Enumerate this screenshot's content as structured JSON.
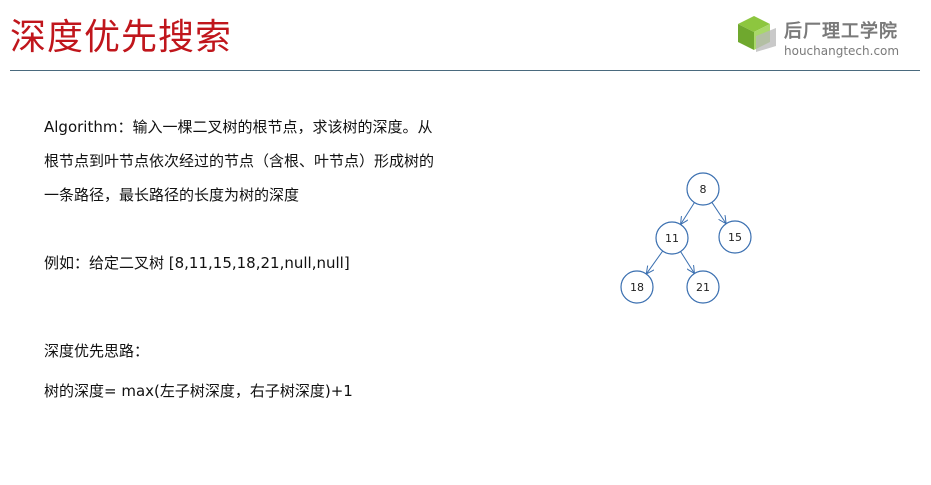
{
  "slide": {
    "title": "深度优先搜索",
    "logo": {
      "brand": "后厂理工学院",
      "domain": "houchangtech.com",
      "accent": "#8dc63f",
      "text_color": "#7a7a7a"
    },
    "problem": "Algorithm：输入一棵二叉树的根节点，求该树的深度。从根节点到叶节点依次经过的节点（含根、叶节点）形成树的一条路径，最长路径的长度为树的深度",
    "example": "例如：给定二叉树 [8,11,15,18,21,null,null]",
    "approach_heading": "深度优先思路：",
    "formula": "树的深度= max(左子树深度，右子树深度)+1",
    "title_color": "#c0161c"
  },
  "tree": {
    "nodes": [
      {
        "id": "n8",
        "label": "8"
      },
      {
        "id": "n11",
        "label": "11"
      },
      {
        "id": "n15",
        "label": "15"
      },
      {
        "id": "n18",
        "label": "18"
      },
      {
        "id": "n21",
        "label": "21"
      }
    ],
    "edges": [
      [
        "n8",
        "n11"
      ],
      [
        "n8",
        "n15"
      ],
      [
        "n11",
        "n18"
      ],
      [
        "n11",
        "n21"
      ]
    ],
    "node_color": "#3a6fb0"
  }
}
